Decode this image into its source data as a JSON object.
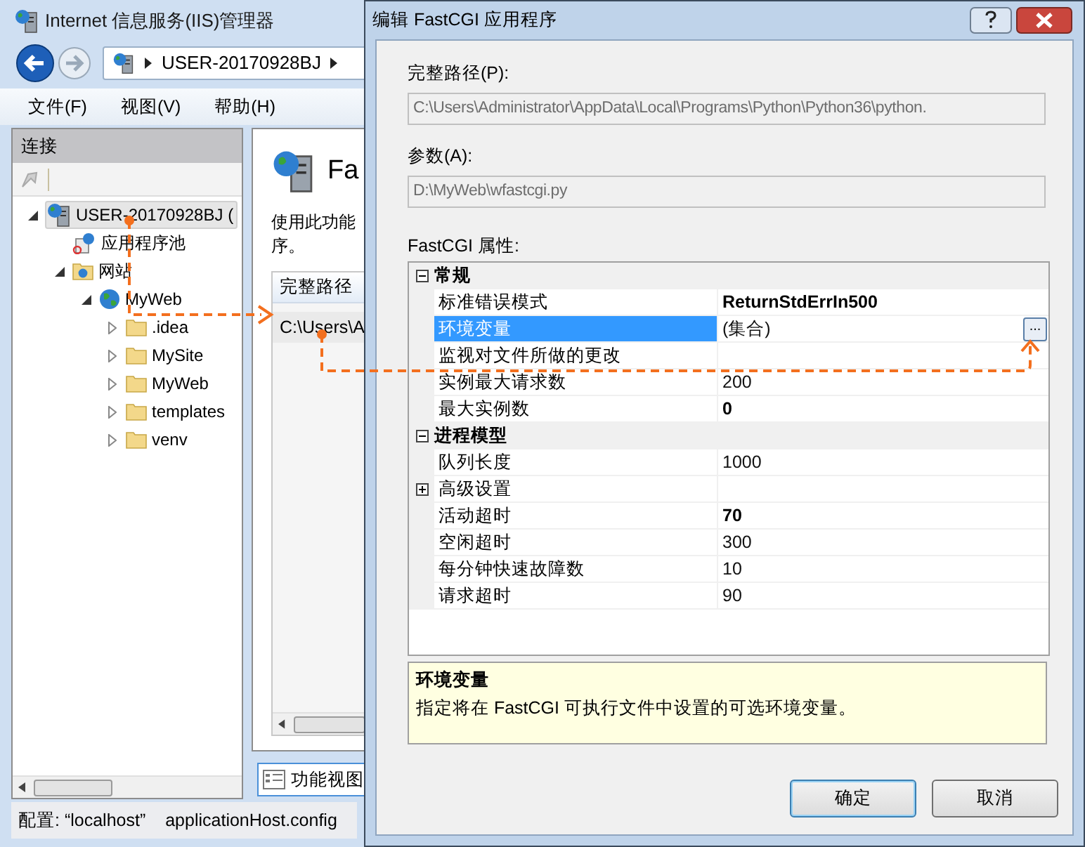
{
  "iis_window": {
    "title": "Internet 信息服务(IIS)管理器",
    "address": [
      {
        "label": "USER-20170928BJ"
      }
    ],
    "menu": [
      {
        "label": "文件(F)"
      },
      {
        "label": "视图(V)"
      },
      {
        "label": "帮助(H)"
      }
    ],
    "connections": {
      "header": "连接",
      "tree": [
        {
          "label": "USER-20170928BJ (",
          "kind": "server",
          "selected": true,
          "expanded": true,
          "children": [
            {
              "label": "应用程序池",
              "kind": "app-pools",
              "selected": false
            },
            {
              "label": "网站",
              "kind": "sites",
              "selected": false,
              "expanded": true,
              "children": [
                {
                  "label": "MyWeb",
                  "kind": "site",
                  "selected": false,
                  "expanded": true,
                  "children": [
                    {
                      "label": ".idea",
                      "kind": "folder",
                      "selected": false,
                      "expanded": false
                    },
                    {
                      "label": "MySite",
                      "kind": "folder",
                      "selected": false,
                      "expanded": false
                    },
                    {
                      "label": "MyWeb",
                      "kind": "folder",
                      "selected": false,
                      "expanded": false
                    },
                    {
                      "label": "templates",
                      "kind": "folder",
                      "selected": false,
                      "expanded": false
                    },
                    {
                      "label": "venv",
                      "kind": "folder",
                      "selected": false,
                      "expanded": false
                    }
                  ]
                }
              ]
            }
          ]
        }
      ]
    },
    "content": {
      "title": "Fa",
      "description": [
        "使用此功能",
        "序。"
      ],
      "table": {
        "columns": [
          "完整路径"
        ],
        "rows": [
          [
            "C:\\Users\\A"
          ]
        ]
      },
      "view_tab": {
        "label": "功能视图",
        "selected": true
      }
    },
    "status_bar": [
      "配置: “localhost”",
      "applicationHost.config"
    ]
  },
  "dialog": {
    "title": "编辑 FastCGI 应用程序",
    "fields": [
      {
        "label": "完整路径(P):",
        "value": "C:\\Users\\Administrator\\AppData\\Local\\Programs\\Python\\Python36\\python.",
        "disabled": true
      },
      {
        "label": "参数(A):",
        "value": "D:\\MyWeb\\wfastcgi.py",
        "disabled": true
      }
    ],
    "grid_label": "FastCGI 属性:",
    "categories": [
      {
        "name": "常规",
        "expanded": true,
        "rows": [
          {
            "label": "标准错误模式",
            "value": "ReturnStdErrIn500",
            "bold": true,
            "selected": false
          },
          {
            "label": "环境变量",
            "value": "(集合)",
            "bold": false,
            "selected": true,
            "button": "..."
          },
          {
            "label": "监视对文件所做的更改",
            "selected": false
          },
          {
            "label": "实例最大请求数",
            "value": "200",
            "bold": false,
            "selected": false
          },
          {
            "label": "最大实例数",
            "value": "0",
            "bold": true,
            "selected": false
          }
        ]
      },
      {
        "name": "进程模型",
        "expanded": true,
        "rows": [
          {
            "label": "队列长度",
            "value": "1000",
            "bold": false,
            "selected": false
          },
          {
            "label": "高级设置",
            "selected": false,
            "expanded": false
          },
          {
            "label": "活动超时",
            "value": "70",
            "bold": true,
            "selected": false
          },
          {
            "label": "空闲超时",
            "value": "300",
            "bold": false,
            "selected": false
          },
          {
            "label": "每分钟快速故障数",
            "value": "10",
            "bold": false,
            "selected": false
          },
          {
            "label": "请求超时",
            "value": "90",
            "bold": false,
            "selected": false
          }
        ]
      }
    ],
    "description": {
      "title": "环境变量",
      "text": "指定将在 FastCGI 可执行文件中设置的可选环境变量。"
    },
    "buttons": [
      {
        "label": "确定",
        "default": true
      },
      {
        "label": "取消",
        "default": false
      }
    ]
  }
}
